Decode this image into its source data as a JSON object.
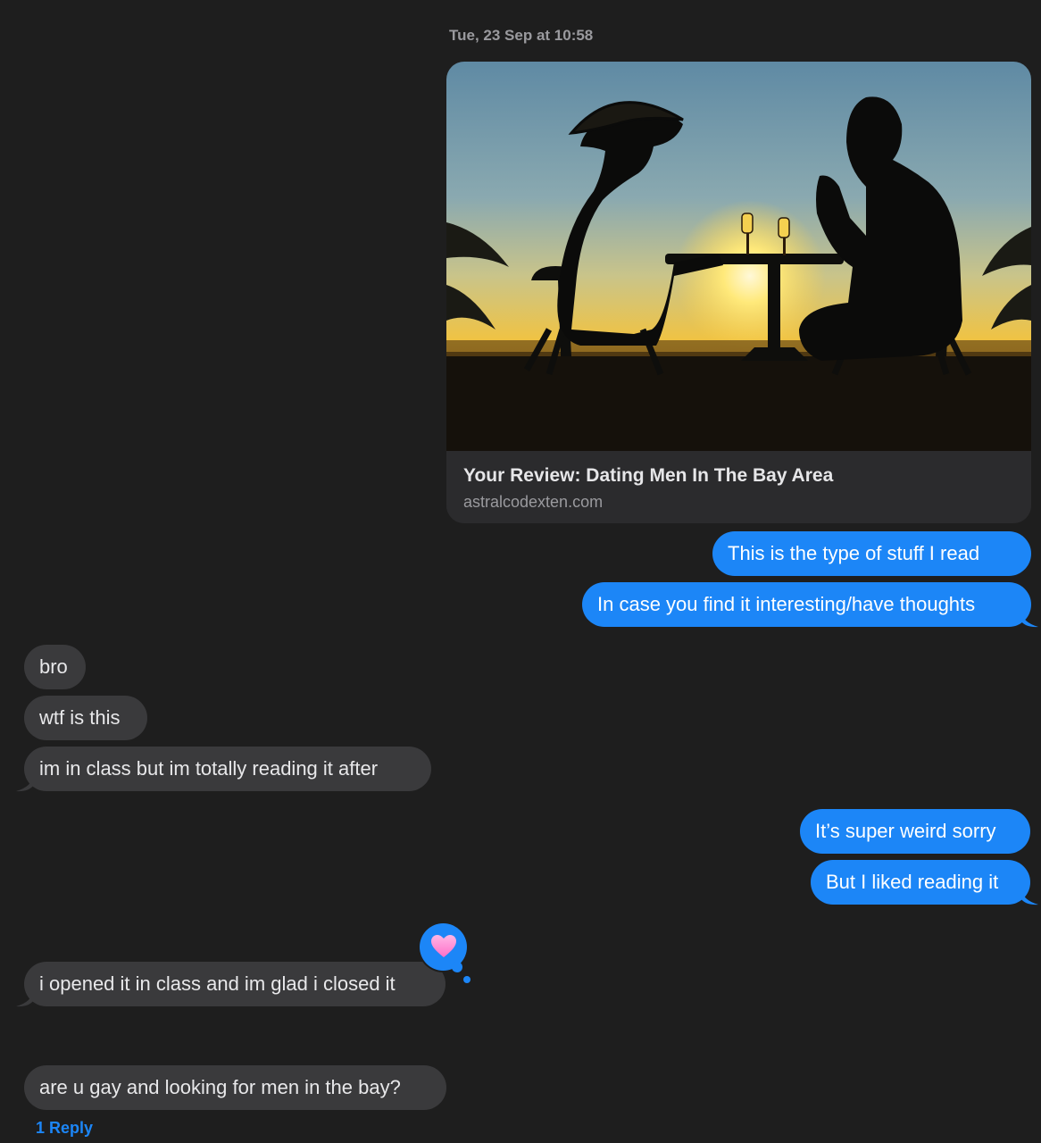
{
  "conversation": {
    "timestamp": "Tue, 23 Sep at 10:58",
    "link_preview": {
      "title": "Your Review: Dating Men In The Bay Area",
      "domain": "astralcodexten.com",
      "image_icon": "couple-silhouette-sunset-image"
    },
    "messages": [
      {
        "id": "m1",
        "side": "sent",
        "text": "This is the type of stuff I read"
      },
      {
        "id": "m2",
        "side": "sent",
        "text": "In case you find it interesting/have thoughts"
      },
      {
        "id": "m3",
        "side": "received",
        "text": "bro"
      },
      {
        "id": "m4",
        "side": "received",
        "text": "wtf is this"
      },
      {
        "id": "m5",
        "side": "received",
        "text": "im in class but im totally reading it after"
      },
      {
        "id": "m6",
        "side": "sent",
        "text": "It’s super weird sorry"
      },
      {
        "id": "m7",
        "side": "sent",
        "text": "But I liked reading it"
      },
      {
        "id": "m8",
        "side": "received",
        "text": "i opened it in class and im glad i closed it",
        "tapback_icon": "pink-heart-icon"
      },
      {
        "id": "m9",
        "side": "received",
        "text": "are u gay and looking for men in the bay?"
      }
    ],
    "reply_count_label": "1 Reply"
  },
  "colors": {
    "background": "#1e1e1e",
    "sent_bubble": "#1c86f7",
    "received_bubble": "#3a3a3c",
    "tapback_heart": "#ff8fd6"
  }
}
